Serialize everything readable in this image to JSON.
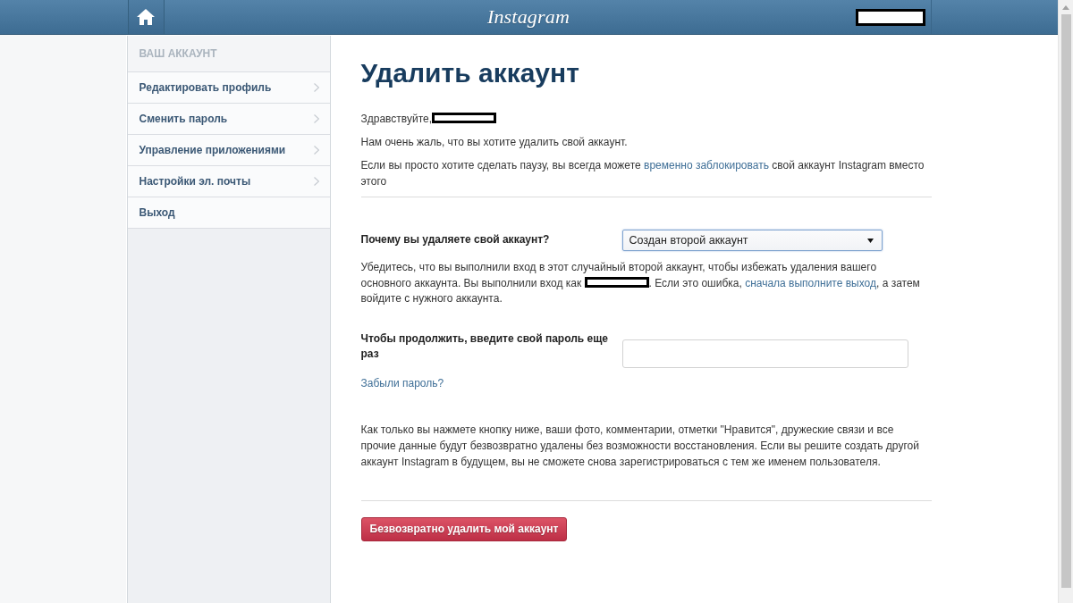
{
  "header": {
    "logo": "Instagram"
  },
  "sidebar": {
    "heading": "ВАШ АККАУНТ",
    "items": [
      {
        "label": "Редактировать профиль",
        "chevron": true
      },
      {
        "label": "Сменить пароль",
        "chevron": true
      },
      {
        "label": "Управление приложениями",
        "chevron": true
      },
      {
        "label": "Настройки эл. почты",
        "chevron": true
      },
      {
        "label": "Выход",
        "chevron": false
      }
    ]
  },
  "page": {
    "title": "Удалить аккаунт",
    "intro": [
      [
        {
          "kind": "text",
          "text": "Здравствуйте,"
        },
        {
          "kind": "redacted"
        }
      ],
      [
        {
          "kind": "text",
          "text": "Нам очень жаль, что вы хотите удалить свой аккаунт."
        }
      ],
      [
        {
          "kind": "text",
          "text": "Если вы просто хотите сделать паузу, вы всегда можете "
        },
        {
          "kind": "link",
          "text": "временно заблокировать"
        },
        {
          "kind": "text",
          "text": " свой аккаунт Instagram вместо этого"
        }
      ]
    ],
    "reason": {
      "label": "Почему вы удаляете свой аккаунт?",
      "value": "Создан второй аккаунт",
      "focused": true
    },
    "note": [
      {
        "kind": "text",
        "text": "Убедитесь, что вы выполнили вход в этот случайный второй аккаунт, чтобы избежать удаления вашего основного аккаунта. Вы выполнили вход как "
      },
      {
        "kind": "redacted"
      },
      {
        "kind": "text",
        "text": ". Если это ошибка, "
      },
      {
        "kind": "link",
        "text": "сначала выполните выход"
      },
      {
        "kind": "text",
        "text": ", а затем войдите с нужного аккаунта."
      }
    ],
    "password": {
      "label": "Чтобы продолжить, введите свой пароль еще раз",
      "forgot_link": "Забыли пароль?"
    },
    "warning": "Как только вы нажмете кнопку ниже, ваши фото, комментарии, отметки \"Нравится\", дружеские связи и все прочие данные будут безвозвратно удалены без возможности восстановления. Если вы решите создать другой аккаунт Instagram в будущем, вы не сможете снова зарегистрироваться с тем же именем пользователя.",
    "delete_button": "Безвозвратно удалить мой аккаунт"
  }
}
